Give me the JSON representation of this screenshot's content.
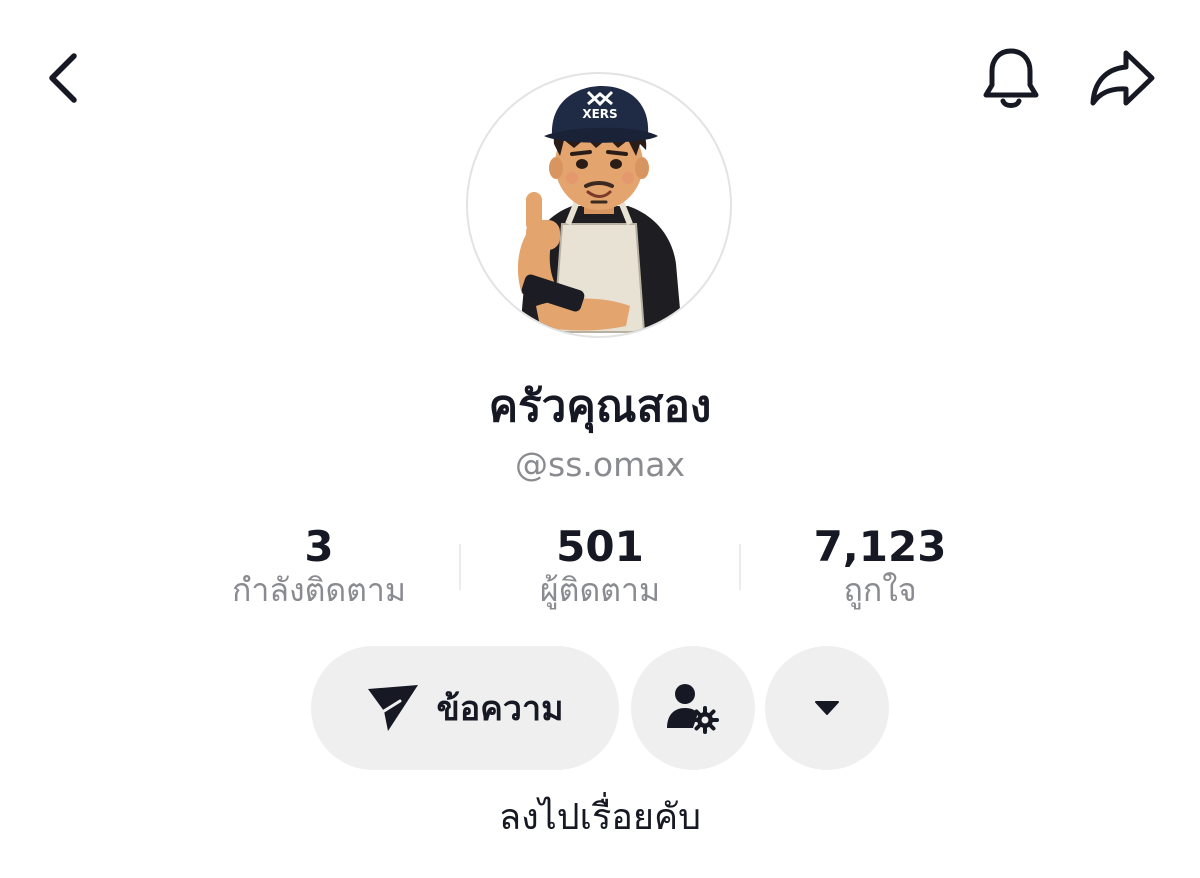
{
  "header": {
    "back_icon": "chevron-left-icon",
    "bell_icon": "bell-icon",
    "share_icon": "share-arrow-icon"
  },
  "profile": {
    "display_name": "ครัวคุณสอง",
    "username": "@ss.omax",
    "avatar_cap_text": "XERS",
    "bio": "ลงไปเรื่อยคับ"
  },
  "stats": [
    {
      "value": "3",
      "label": "กำลังติดตาม"
    },
    {
      "value": "501",
      "label": "ผู้ติดตาม"
    },
    {
      "value": "7,123",
      "label": "ถูกใจ"
    }
  ],
  "actions": {
    "message_label": "ข้อความ",
    "message_icon": "send-icon",
    "friend_settings_icon": "person-gear-icon",
    "more_icon": "caret-down-icon"
  },
  "colors": {
    "text_primary": "#161823",
    "text_secondary": "#8a8b91",
    "button_bg": "#efeff0",
    "background": "#ffffff"
  }
}
